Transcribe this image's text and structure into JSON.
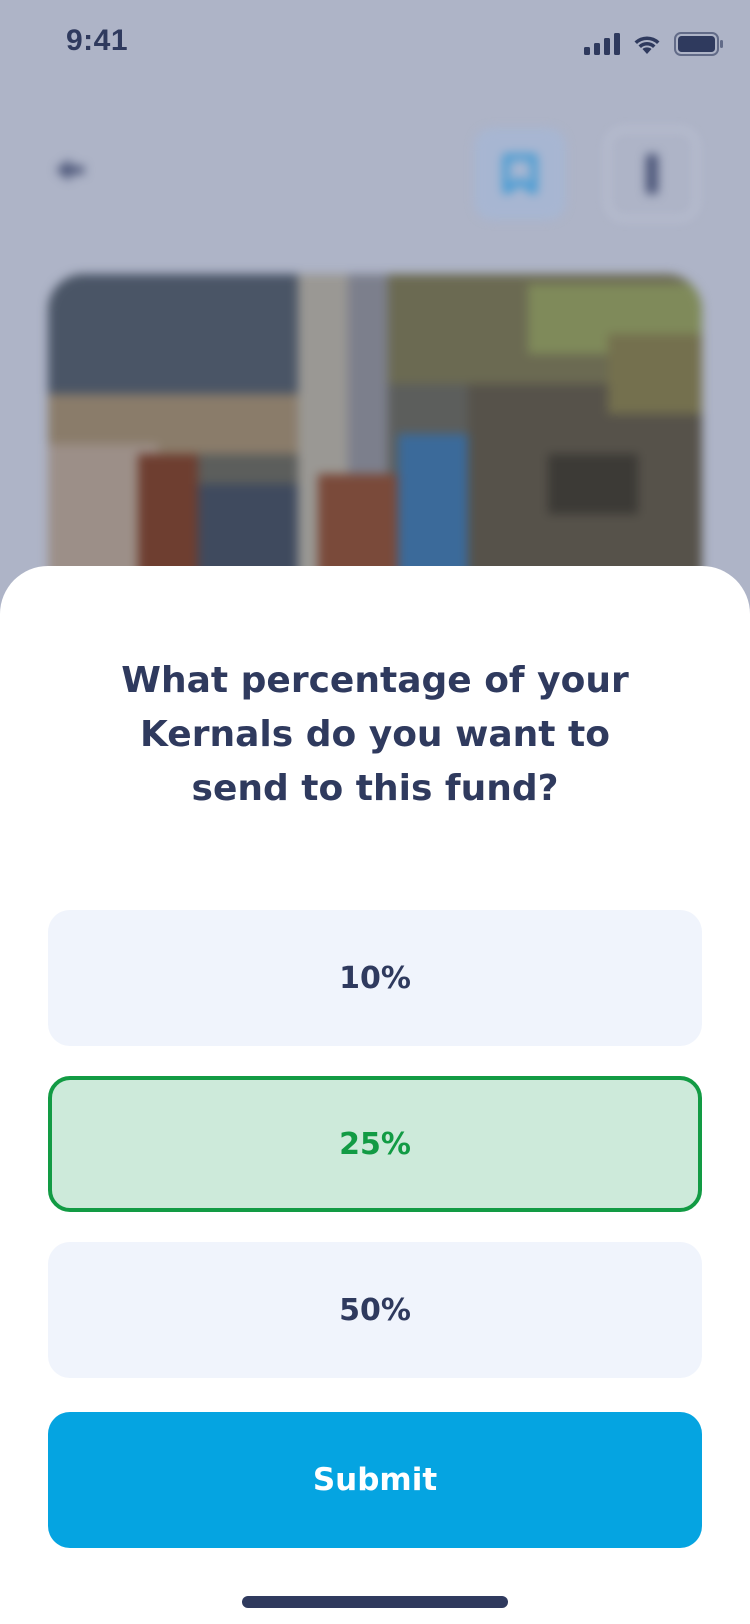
{
  "status_bar": {
    "time": "9:41",
    "icons": [
      "signal-icon",
      "wifi-icon",
      "battery-icon"
    ]
  },
  "header": {
    "back_icon": "arrow-left-icon",
    "bookmark_icon": "bookmark-icon",
    "more_icon": "more-icon"
  },
  "hero": {
    "image": "aerial-town-photo"
  },
  "sheet": {
    "question_lines": [
      "What percentage of your",
      "Kernals do you want to",
      "send to this fund?"
    ],
    "options": [
      {
        "label": "10%",
        "selected": false
      },
      {
        "label": "25%",
        "selected": true
      },
      {
        "label": "50%",
        "selected": false
      }
    ],
    "submit_label": "Submit"
  },
  "colors": {
    "text_primary": "#2f3a5e",
    "option_bg": "#f0f4fc",
    "selected_bg": "#cdeada",
    "selected_accent": "#129b44",
    "submit_bg": "#05a4e1",
    "overlay": "#aeb4c7"
  }
}
